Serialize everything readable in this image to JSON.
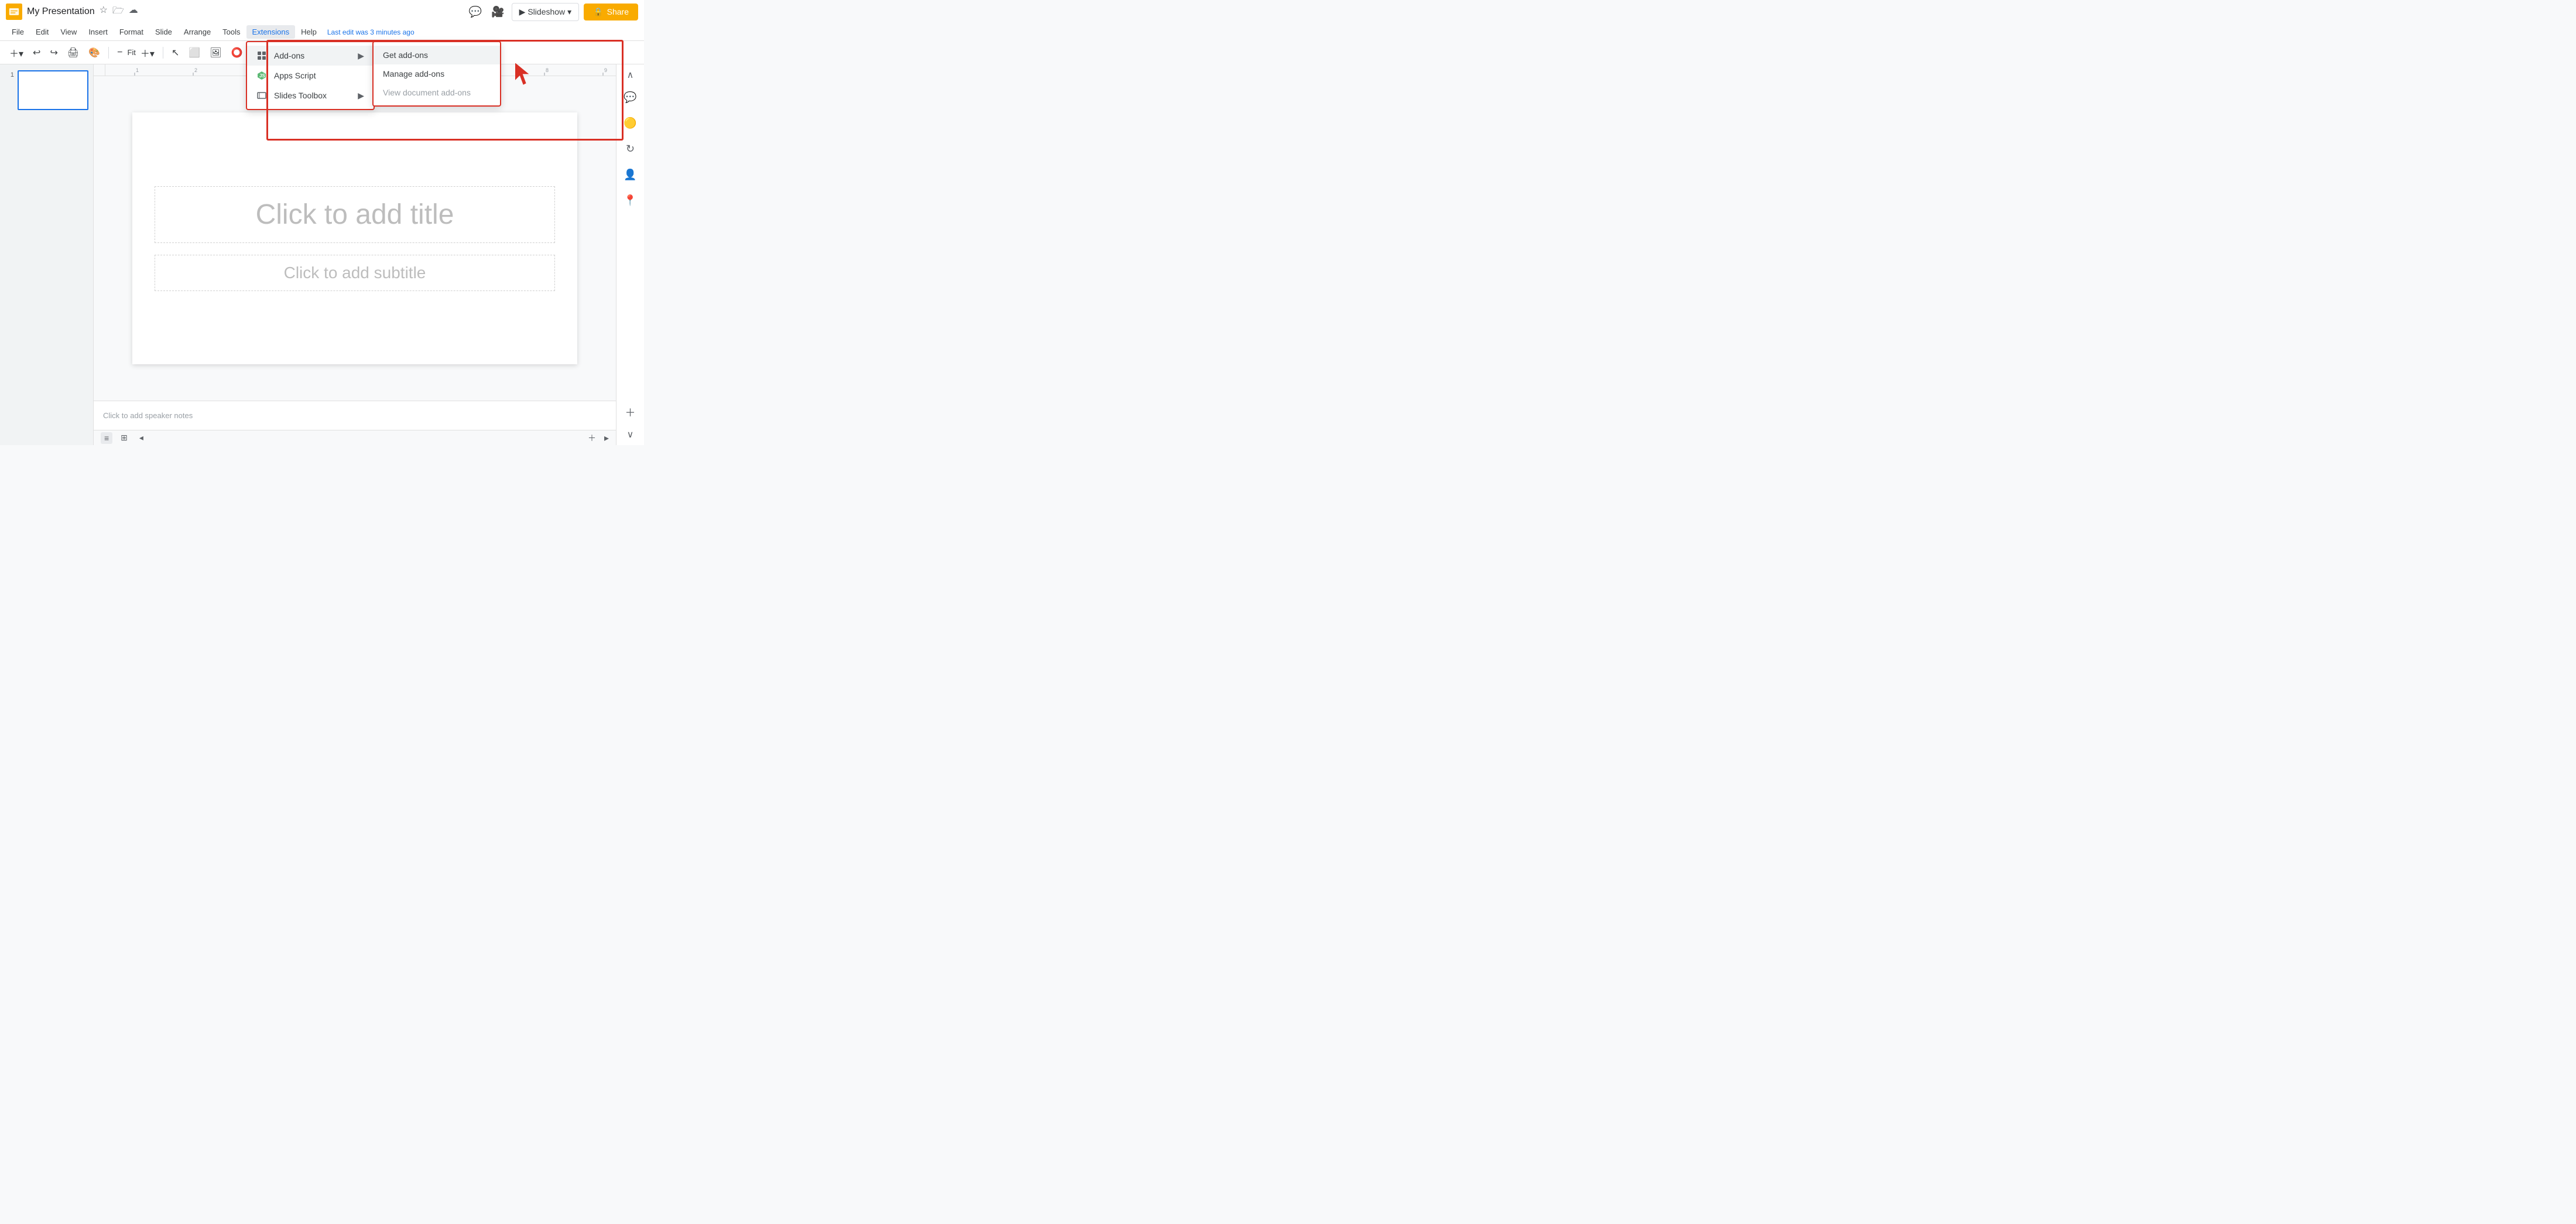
{
  "app": {
    "title": "My Presentation",
    "icon_color": "#f9ab00"
  },
  "titlebar": {
    "title": "My Presentation",
    "last_edit": "Last edit was 3 minutes ago",
    "slideshow_label": "Slideshow",
    "share_label": "Share"
  },
  "menubar": {
    "items": [
      {
        "id": "file",
        "label": "File"
      },
      {
        "id": "edit",
        "label": "Edit"
      },
      {
        "id": "view",
        "label": "View"
      },
      {
        "id": "insert",
        "label": "Insert"
      },
      {
        "id": "format",
        "label": "Format"
      },
      {
        "id": "slide",
        "label": "Slide"
      },
      {
        "id": "arrange",
        "label": "Arrange"
      },
      {
        "id": "tools",
        "label": "Tools"
      },
      {
        "id": "extensions",
        "label": "Extensions"
      },
      {
        "id": "help",
        "label": "Help"
      }
    ]
  },
  "toolbar": {
    "zoom_label": "Fit"
  },
  "extensions_menu": {
    "items": [
      {
        "id": "addons",
        "label": "Add-ons",
        "has_arrow": true,
        "icon": "puzzle"
      },
      {
        "id": "apps_script",
        "label": "Apps Script",
        "has_arrow": false,
        "icon": "apps_script"
      },
      {
        "id": "slides_toolbox",
        "label": "Slides Toolbox",
        "has_arrow": true,
        "icon": "slides_toolbox"
      }
    ]
  },
  "addons_submenu": {
    "items": [
      {
        "id": "get_addons",
        "label": "Get add-ons",
        "disabled": false
      },
      {
        "id": "manage_addons",
        "label": "Manage add-ons",
        "disabled": false
      },
      {
        "id": "view_doc_addons",
        "label": "View document add-ons",
        "disabled": true
      }
    ]
  },
  "slide": {
    "title_placeholder": "Click to add title",
    "subtitle_placeholder": "Click to add subtitle"
  },
  "notes": {
    "placeholder": "Click to add speaker notes"
  },
  "slide_number": "1"
}
